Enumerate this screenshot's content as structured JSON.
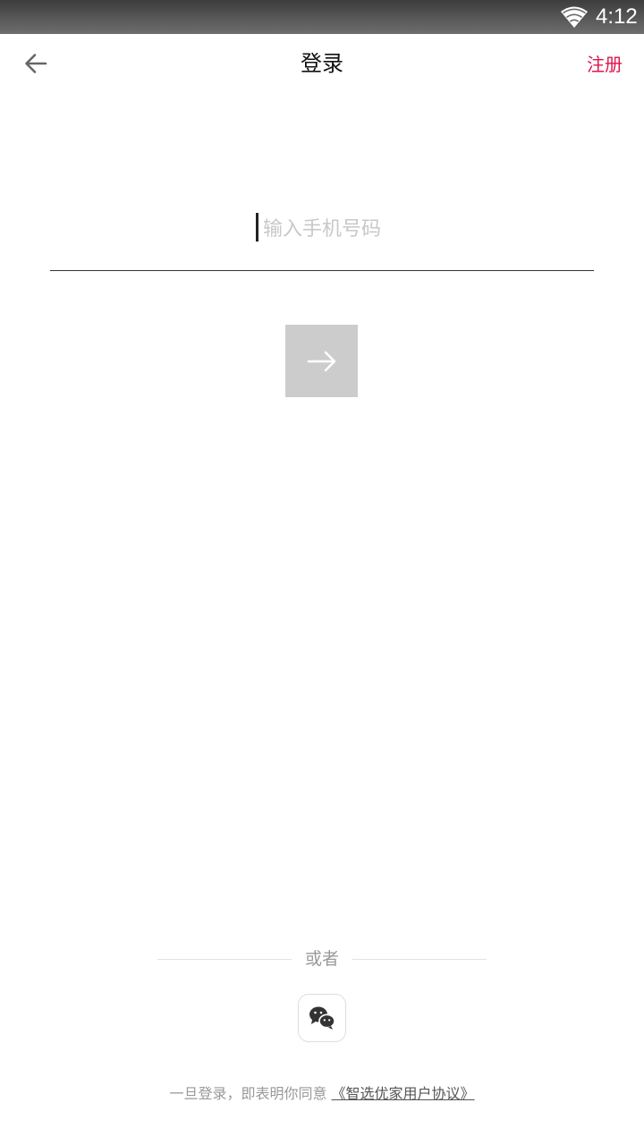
{
  "status_bar": {
    "time": "4:12",
    "wifi_icon": "wifi-icon"
  },
  "header": {
    "back_icon": "arrow-left-icon",
    "title": "登录",
    "register_label": "注册",
    "register_color": "#e0144b"
  },
  "login_form": {
    "phone_placeholder": "输入手机号码",
    "phone_value": "",
    "next_icon": "arrow-right-icon",
    "next_button_color": "#cccccc"
  },
  "social_login": {
    "or_label": "或者",
    "wechat_icon": "wechat-icon"
  },
  "agreement": {
    "prefix": "一旦登录，即表明你同意",
    "link_label": "《智选优家用户协议》"
  }
}
